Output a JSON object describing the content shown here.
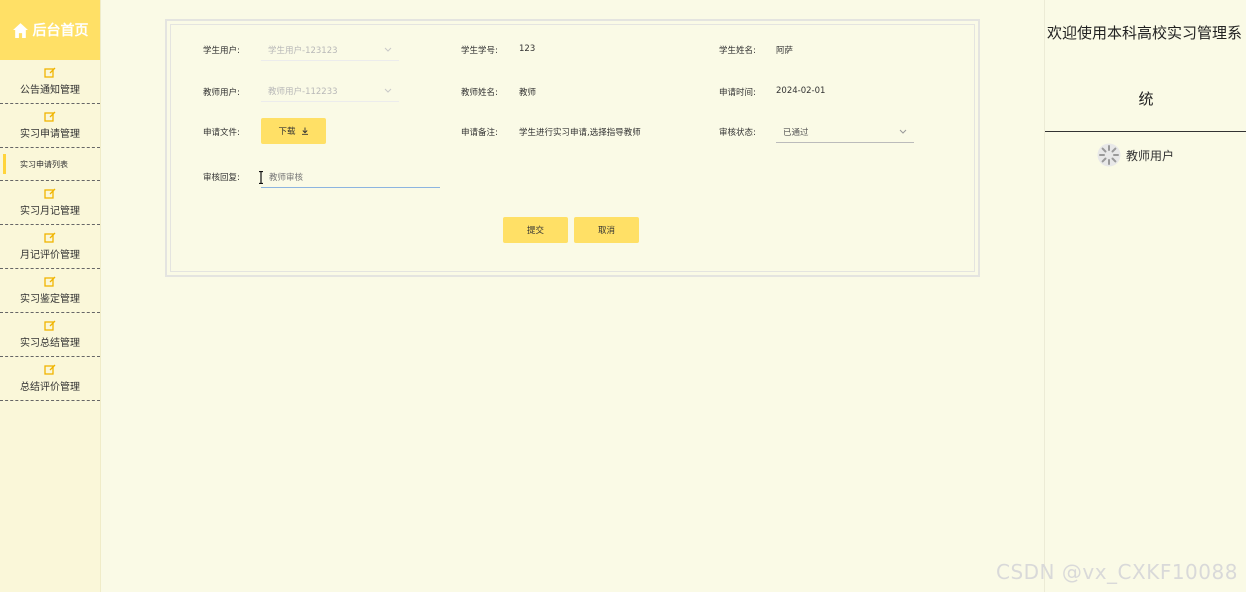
{
  "sidebar": {
    "brand": "后台首页",
    "items": [
      {
        "label": "公告通知管理"
      },
      {
        "label": "实习申请管理"
      },
      {
        "label": "实习月记管理"
      },
      {
        "label": "月记评价管理"
      },
      {
        "label": "实习鉴定管理"
      },
      {
        "label": "实习总结管理"
      },
      {
        "label": "总结评价管理"
      }
    ],
    "active_sub": "实习申请列表"
  },
  "form": {
    "student_user_label": "学生用户:",
    "student_user_value": "学生用户-123123",
    "student_no_label": "学生学号:",
    "student_no_value": "123",
    "student_name_label": "学生姓名:",
    "student_name_value": "阿萨",
    "teacher_user_label": "教师用户:",
    "teacher_user_value": "教师用户-112233",
    "teacher_name_label": "教师姓名:",
    "teacher_name_value": "教师",
    "apply_time_label": "申请时间:",
    "apply_time_value": "2024-02-01",
    "apply_file_label": "申请文件:",
    "download_label": "下载",
    "remark_label": "申请备注:",
    "remark_value": "学生进行实习申请,选择指导教师",
    "status_label": "审核状态:",
    "status_value": "已通过",
    "reply_label": "审核回复:",
    "reply_value": "教师审核",
    "submit_label": "提交",
    "cancel_label": "取消"
  },
  "header": {
    "title_line1": "欢迎使用本科高校实习管理系",
    "title_line2": "统",
    "user_name": "教师用户"
  },
  "watermark": "CSDN @vx_CXKF10088",
  "colors": {
    "accent": "#ffe066",
    "background": "#fafae6",
    "sidebar": "#faf7d9"
  }
}
